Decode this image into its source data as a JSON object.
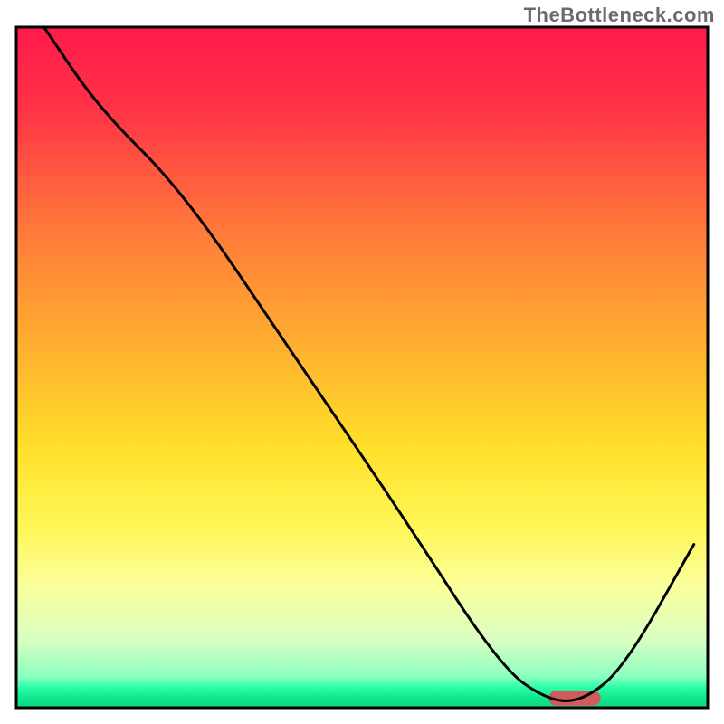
{
  "watermark": "TheBottleneck.com",
  "chart_data": {
    "type": "line",
    "title": "",
    "xlabel": "",
    "ylabel": "",
    "xlim": [
      0,
      100
    ],
    "ylim": [
      0,
      100
    ],
    "grid": false,
    "legend": false,
    "gradient_stops": [
      {
        "offset": 0.0,
        "color": "#ff1a4b"
      },
      {
        "offset": 0.12,
        "color": "#ff3347"
      },
      {
        "offset": 0.3,
        "color": "#ff7a3a"
      },
      {
        "offset": 0.48,
        "color": "#ffb32f"
      },
      {
        "offset": 0.62,
        "color": "#ffe12a"
      },
      {
        "offset": 0.74,
        "color": "#fff75a"
      },
      {
        "offset": 0.82,
        "color": "#fbff9a"
      },
      {
        "offset": 0.9,
        "color": "#d9ffc2"
      },
      {
        "offset": 0.955,
        "color": "#8affc0"
      },
      {
        "offset": 0.97,
        "color": "#2bffa8"
      },
      {
        "offset": 0.985,
        "color": "#10e88f"
      },
      {
        "offset": 1.0,
        "color": "#0fd680"
      }
    ],
    "series": [
      {
        "name": "bottleneck-curve",
        "color": "#000000",
        "stroke_width": 3,
        "x": [
          4,
          12,
          24,
          40,
          56,
          70,
          77,
          82,
          88,
          98
        ],
        "y": [
          100,
          88,
          76,
          52,
          28,
          6,
          1,
          1,
          6,
          24
        ]
      }
    ],
    "marker": {
      "name": "optimal-range",
      "color": "#d15a5a",
      "x_start": 77,
      "x_end": 84.5,
      "y": 1.4,
      "height": 2.2
    },
    "frame": {
      "color": "#000000",
      "stroke_width": 3
    }
  }
}
